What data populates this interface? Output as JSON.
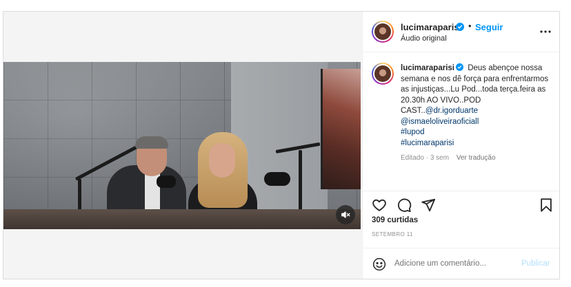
{
  "post": {
    "username": "lucimaraparisi",
    "follow_label": "Seguir",
    "separator": "•",
    "audio_label": "Áudio original",
    "caption": {
      "username": "lucimaraparisi",
      "text": "Deus abençoe nossa semana e nos dê força para enfrentarmos as injustiças...Lu Pod...toda terça.feira as 20.30h AO VIVO..POD CAST..",
      "mentions": [
        "@dr.igorduarte",
        "@ismaeloliveiraoficiall"
      ],
      "hashtags": [
        "#lupod",
        "#lucimaraparisi"
      ],
      "edited_label": "Editado",
      "time_ago": "3 sem",
      "translate_label": "Ver tradução"
    },
    "likes_label": "309 curtidas",
    "date_label": "SETEMBRO 11",
    "comment": {
      "placeholder": "Adicione um comentário...",
      "publish_label": "Publicar"
    }
  },
  "icons": {
    "verified": "verified-badge-icon",
    "more": "more-options-icon",
    "like": "heart-icon",
    "comment": "comment-bubble-icon",
    "share": "paper-plane-icon",
    "save": "bookmark-icon",
    "emoji": "emoji-smile-icon",
    "mute": "muted-speaker-icon"
  },
  "colors": {
    "accent": "#0095f6",
    "text": "#262626",
    "muted": "#8e8e8e",
    "link": "#00376b",
    "publish_disabled": "#b2dffc"
  }
}
